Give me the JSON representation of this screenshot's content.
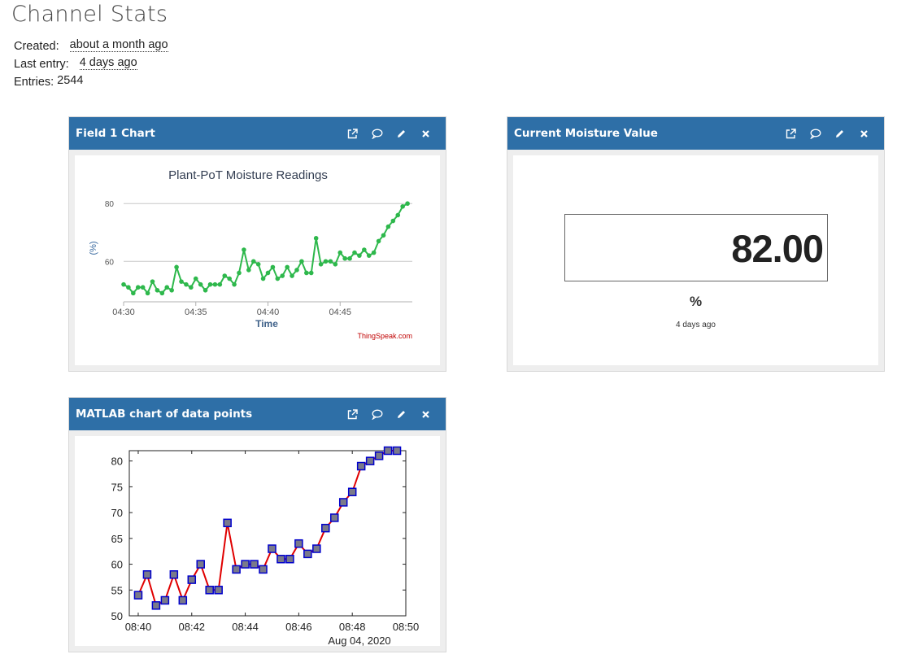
{
  "page": {
    "title": "Channel Stats",
    "created_label": "Created:",
    "created_value": "about a month ago",
    "last_entry_label": "Last entry:",
    "last_entry_value": "4 days ago",
    "entries_label": "Entries:",
    "entries_value": "2544"
  },
  "widgets": {
    "field1": {
      "title": "Field 1 Chart"
    },
    "moisture": {
      "title": "Current Moisture Value",
      "value": "82.00",
      "unit": "%",
      "updated": "4 days ago"
    },
    "matlab": {
      "title": "MATLAB chart of data points"
    }
  },
  "icons": [
    "external-link-icon",
    "comment-icon",
    "pencil-icon",
    "close-icon"
  ],
  "colors": {
    "header": "#2e6fa7",
    "line_green": "#2eb84c",
    "line_red": "#e00000",
    "marker_fill": "#7a7a8a",
    "marker_edge": "#0000cc"
  },
  "chart_data": [
    {
      "type": "line",
      "title": "Plant-PoT Moisture Readings",
      "xlabel": "Time",
      "ylabel": "(%)",
      "credit": "ThingSpeak.com",
      "xticks": [
        "04:30",
        "04:35",
        "04:40",
        "04:45"
      ],
      "yticks": [
        60,
        80
      ],
      "xlim": [
        "04:30",
        "04:50"
      ],
      "ylim": [
        46,
        84
      ],
      "grid": true,
      "series": [
        {
          "x": [
            "04:30:00",
            "04:30:20",
            "04:30:40",
            "04:31:00",
            "04:31:20",
            "04:31:40",
            "04:32:00",
            "04:32:20",
            "04:32:40",
            "04:33:00",
            "04:33:20",
            "04:33:40",
            "04:34:00",
            "04:34:20",
            "04:34:40",
            "04:35:00",
            "04:35:20",
            "04:35:40",
            "04:36:00",
            "04:36:20",
            "04:36:40",
            "04:37:00",
            "04:37:20",
            "04:37:40",
            "04:38:00",
            "04:38:20",
            "04:38:40",
            "04:39:00",
            "04:39:20",
            "04:39:40",
            "04:40:00",
            "04:40:20",
            "04:40:40",
            "04:41:00",
            "04:41:20",
            "04:41:40",
            "04:42:00",
            "04:42:20",
            "04:42:40",
            "04:43:00",
            "04:43:20",
            "04:43:40",
            "04:44:00",
            "04:44:20",
            "04:44:40",
            "04:45:00",
            "04:45:20",
            "04:45:40",
            "04:46:00",
            "04:46:20",
            "04:46:40",
            "04:47:00",
            "04:47:20",
            "04:47:40",
            "04:48:00",
            "04:48:20",
            "04:48:40",
            "04:49:00",
            "04:49:20",
            "04:49:40"
          ],
          "y": [
            52,
            51,
            49,
            51,
            51,
            49,
            53,
            50,
            49,
            51,
            50,
            58,
            53,
            52,
            51,
            54,
            52,
            50,
            52,
            52,
            52,
            55,
            54,
            52,
            56,
            64,
            57,
            60,
            59,
            54,
            56,
            58,
            54,
            55,
            58,
            55,
            57,
            60,
            56,
            56,
            68,
            59,
            60,
            60,
            59,
            63,
            61,
            61,
            63,
            62,
            64,
            62,
            63,
            67,
            69,
            72,
            74,
            76,
            79,
            80
          ]
        }
      ]
    },
    {
      "type": "line",
      "title": "",
      "xlabel": "",
      "date_label": "Aug 04, 2020",
      "xticks": [
        "08:40",
        "08:42",
        "08:44",
        "08:46",
        "08:48",
        "08:50"
      ],
      "yticks": [
        50,
        55,
        60,
        65,
        70,
        75,
        80
      ],
      "xlim": [
        "08:39:40",
        "08:50:00"
      ],
      "ylim": [
        50,
        82
      ],
      "grid": false,
      "series": [
        {
          "x": [
            "08:40:00",
            "08:40:20",
            "08:40:40",
            "08:41:00",
            "08:41:20",
            "08:41:40",
            "08:42:00",
            "08:42:20",
            "08:42:40",
            "08:43:00",
            "08:43:20",
            "08:43:40",
            "08:44:00",
            "08:44:20",
            "08:44:40",
            "08:45:00",
            "08:45:20",
            "08:45:40",
            "08:46:00",
            "08:46:20",
            "08:46:40",
            "08:47:00",
            "08:47:20",
            "08:47:40",
            "08:48:00",
            "08:48:20",
            "08:48:40",
            "08:49:00",
            "08:49:20",
            "08:49:40"
          ],
          "y": [
            54,
            58,
            52,
            53,
            58,
            53,
            57,
            60,
            55,
            55,
            68,
            59,
            60,
            60,
            59,
            63,
            61,
            61,
            64,
            62,
            63,
            67,
            69,
            72,
            74,
            79,
            80,
            81,
            82,
            82
          ]
        }
      ]
    }
  ]
}
